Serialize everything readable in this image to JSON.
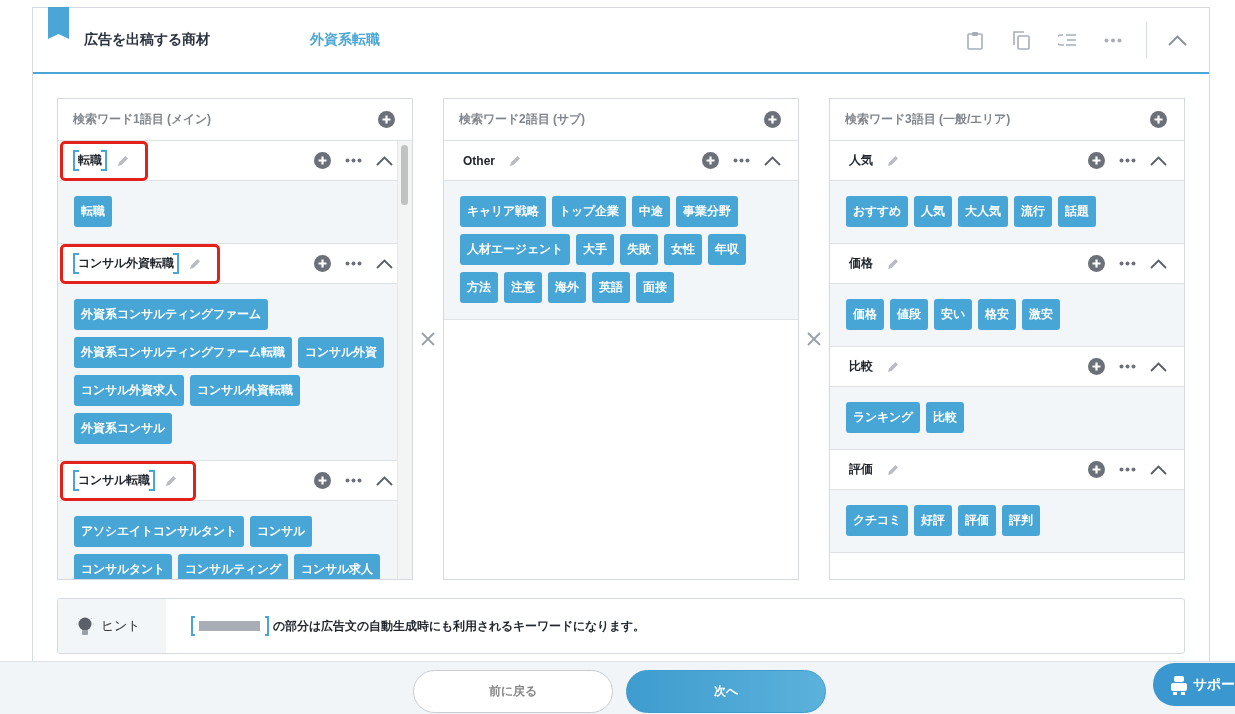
{
  "header": {
    "title": "広告を出稿する商材",
    "value": "外資系転職"
  },
  "columns": [
    {
      "title": "検索ワード1語目 (メイン)",
      "scrollbar": true,
      "groups": [
        {
          "name": "転職",
          "bracketed": true,
          "highlighted": true,
          "expanded": true,
          "keywords": [
            "転職"
          ]
        },
        {
          "name": "コンサル外資転職",
          "bracketed": true,
          "highlighted": true,
          "expanded": true,
          "keywords": [
            "外資系コンサルティングファーム",
            "外資系コンサルティングファーム転職",
            "コンサル外資",
            "コンサル外資求人",
            "コンサル外資転職",
            "外資系コンサル"
          ]
        },
        {
          "name": "コンサル転職",
          "bracketed": true,
          "highlighted": true,
          "expanded": true,
          "keywords": [
            "アソシエイトコンサルタント",
            "コンサル",
            "コンサルタント",
            "コンサルティング",
            "コンサル求人"
          ]
        }
      ]
    },
    {
      "title": "検索ワード2語目 (サブ)",
      "scrollbar": false,
      "groups": [
        {
          "name": "Other",
          "bracketed": false,
          "highlighted": false,
          "expanded": true,
          "keywords": [
            "キャリア戦略",
            "トップ企業",
            "中途",
            "事業分野",
            "人材エージェント",
            "大手",
            "失敗",
            "女性",
            "年収",
            "方法",
            "注意",
            "海外",
            "英語",
            "面接"
          ]
        }
      ]
    },
    {
      "title": "検索ワード3語目 (一般/エリア)",
      "scrollbar": false,
      "groups": [
        {
          "name": "人気",
          "bracketed": false,
          "highlighted": false,
          "expanded": true,
          "keywords": [
            "おすすめ",
            "人気",
            "大人気",
            "流行",
            "話題"
          ]
        },
        {
          "name": "価格",
          "bracketed": false,
          "highlighted": false,
          "expanded": true,
          "keywords": [
            "価格",
            "値段",
            "安い",
            "格安",
            "激安"
          ]
        },
        {
          "name": "比較",
          "bracketed": false,
          "highlighted": false,
          "expanded": true,
          "keywords": [
            "ランキング",
            "比較"
          ]
        },
        {
          "name": "評価",
          "bracketed": false,
          "highlighted": false,
          "expanded": true,
          "keywords": [
            "クチコミ",
            "好評",
            "評価",
            "評判"
          ]
        }
      ]
    }
  ],
  "hint": {
    "label": "ヒント",
    "text": "の部分は広告文の自動生成時にも利用されるキーワードになります。"
  },
  "footer": {
    "back": "前に戻る",
    "next": "次へ"
  },
  "support": "サポー"
}
